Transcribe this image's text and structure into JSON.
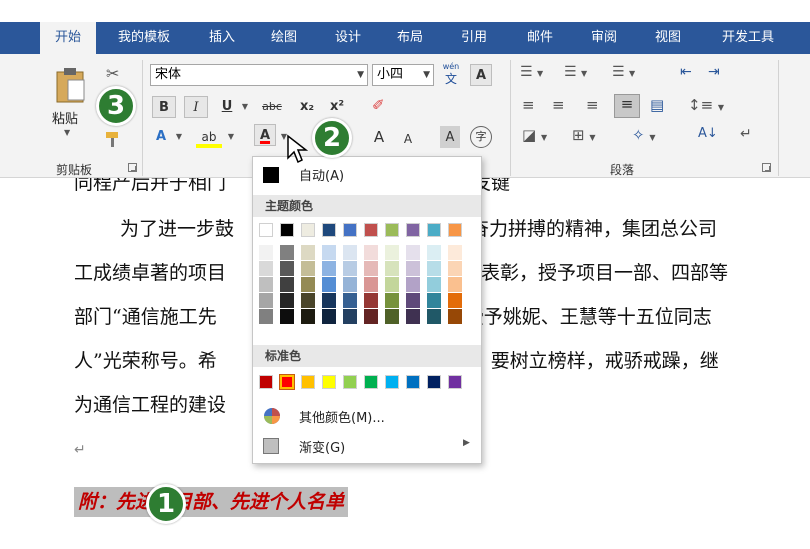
{
  "tabs": [
    {
      "label": "开始",
      "active": true
    },
    {
      "label": "我的模板"
    },
    {
      "label": "插入"
    },
    {
      "label": "绘图"
    },
    {
      "label": "设计"
    },
    {
      "label": "布局"
    },
    {
      "label": "引用"
    },
    {
      "label": "邮件"
    },
    {
      "label": "审阅"
    },
    {
      "label": "视图"
    },
    {
      "label": "开发工具"
    }
  ],
  "clipboard": {
    "paste_label": "粘贴",
    "group_label": "剪贴板"
  },
  "font": {
    "name": "宋体",
    "size": "小四",
    "phonetic_top": "wén",
    "phonetic_bottom": "文",
    "char_border": "A",
    "bold": "B",
    "italic": "I",
    "underline": "U",
    "strike": "abc",
    "sub": "x₂",
    "sup": "x²",
    "text_effect": "A",
    "highlight": "ab",
    "font_color": "A",
    "grow": "A",
    "shrink": "A",
    "char_shade": "A",
    "enclose": "字"
  },
  "paragraph": {
    "group_label": "段落"
  },
  "colors": {
    "accent": "#2b579a",
    "font_color_red": "#ff0000",
    "badge": "#2e7d32",
    "caption_red": "#c00000"
  },
  "dropdown": {
    "auto_label": "自动(A)",
    "theme_header": "主题颜色",
    "theme_colors": [
      [
        "#ffffff",
        "#f2f2f2",
        "#d9d9d9",
        "#bfbfbf",
        "#a6a6a6",
        "#808080"
      ],
      [
        "#000000",
        "#808080",
        "#595959",
        "#404040",
        "#262626",
        "#0d0d0d"
      ],
      [
        "#eeece1",
        "#ddd9c3",
        "#c4bd97",
        "#948a54",
        "#4a452a",
        "#1d1b10"
      ],
      [
        "#1f497d",
        "#c6d9f0",
        "#8db3e2",
        "#548dd4",
        "#17365d",
        "#0f243e"
      ],
      [
        "#4472c4",
        "#dbe5f1",
        "#b8cce4",
        "#95b3d7",
        "#366092",
        "#244061"
      ],
      [
        "#c0504d",
        "#f2dcdb",
        "#e5b9b7",
        "#d99694",
        "#953734",
        "#632423"
      ],
      [
        "#9bbb59",
        "#ebf1dd",
        "#d7e3bc",
        "#c3d69b",
        "#76923c",
        "#4f6128"
      ],
      [
        "#8064a2",
        "#e5e0ec",
        "#ccc1d9",
        "#b2a2c7",
        "#5f497a",
        "#3f3151"
      ],
      [
        "#4bacc6",
        "#dbeef3",
        "#b7dde8",
        "#92cddc",
        "#31859b",
        "#205867"
      ],
      [
        "#f79646",
        "#fdeada",
        "#fbd5b5",
        "#fac08f",
        "#e36c09",
        "#974806"
      ]
    ],
    "standard_header": "标准色",
    "standard_colors": [
      "#c00000",
      "#ff0000",
      "#ffc000",
      "#ffff00",
      "#92d050",
      "#00b050",
      "#00b0f0",
      "#0070c0",
      "#002060",
      "#7030a0"
    ],
    "more_colors_label": "其他颜色(M)...",
    "gradient_label": "渐变(G)"
  },
  "document": {
    "line0": "同程产后并于相门",
    "line0b": "金王应宝发键",
    "line1a": "为了进一步鼓",
    "line1b": "奋力拼搏的精神，集团总公司",
    "line2a": "工成绩卓著的项目",
    "line2b": "行表彰，授予项目一部、四部等",
    "line3a": "部门“通信施工先",
    "line3b": "授予姚妮、王慧等十五位同志",
    "line4a": "人”光荣称号。希",
    "line4b": "人，要树立榜样，戒骄戒躁，继",
    "line5": "为通信工程的建设",
    "para_mark": "↵",
    "caption": "附：先进项目部、先进个人名单"
  },
  "badges": [
    "1",
    "2",
    "3"
  ]
}
